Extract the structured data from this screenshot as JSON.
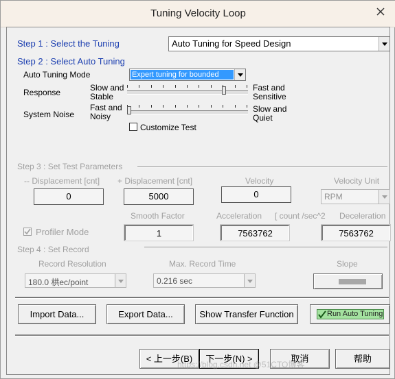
{
  "window": {
    "title": "Tuning Velocity Loop"
  },
  "step1": {
    "label": "Step 1 : Select the  Tuning",
    "select_value": "Auto Tuning for Speed Design"
  },
  "step2": {
    "label": "Step 2 : Select Auto Tuning",
    "mode_label": "Auto Tuning Mode",
    "mode_value": "Expert tuning for bounded",
    "response_label": "Response",
    "response_left": [
      "Slow and",
      "Stable"
    ],
    "response_right": [
      "Fast and",
      "Sensitive"
    ],
    "noise_label": "System Noise",
    "noise_left": [
      "Fast and",
      "Noisy"
    ],
    "noise_right": [
      "Slow and",
      "Quiet"
    ],
    "customize_label": "Customize Test"
  },
  "step3": {
    "label": "Step 3 : Set Test  Parameters",
    "neg_disp_label": "-- Displacement [cnt]",
    "neg_disp_value": "0",
    "pos_disp_label": "+ Displacement [cnt]",
    "pos_disp_value": "5000",
    "velocity_label": "Velocity",
    "velocity_value": "0",
    "velocity_unit_label": "Velocity Unit",
    "velocity_unit_value": "RPM",
    "profiler_label": "Profiler Mode",
    "smooth_label": "Smooth Factor",
    "smooth_value": "1",
    "accel_label": "Acceleration",
    "accel_unit": "[ count /sec^2",
    "accel_value": "7563762",
    "decel_label": "Deceleration",
    "decel_value": "7563762"
  },
  "step4": {
    "label": "Step 4 : Set Record",
    "resolution_label": "Record Resolution",
    "resolution_value": "180.0 栱ec/point",
    "max_time_label": "Max. Record Time",
    "max_time_value": "0.216 sec",
    "slope_label": "Slope"
  },
  "buttons": {
    "import": "Import Data...",
    "export": "Export Data...",
    "transfer": "Show Transfer Function",
    "run": "Run Auto Tuning",
    "back": "< 上一步(B)",
    "next": "下一步(N) >",
    "cancel": "取消",
    "help": "帮助"
  },
  "watermark": "https://blog.csdn.net @51CTO博客"
}
